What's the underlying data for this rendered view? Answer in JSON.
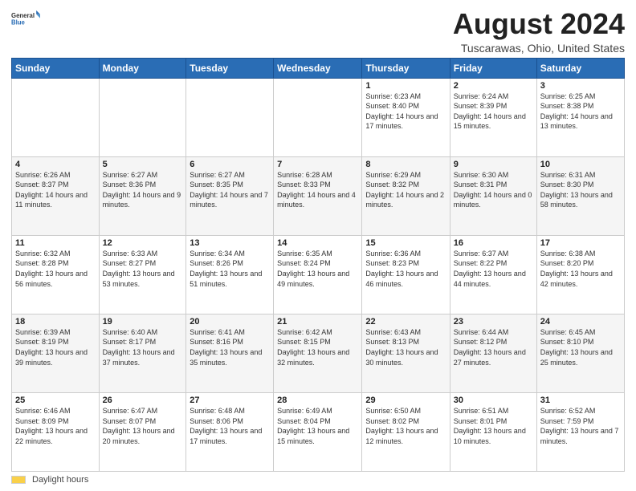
{
  "logo": {
    "general": "General",
    "blue": "Blue"
  },
  "title": "August 2024",
  "subtitle": "Tuscarawas, Ohio, United States",
  "legend": {
    "label": "Daylight hours"
  },
  "days_header": [
    "Sunday",
    "Monday",
    "Tuesday",
    "Wednesday",
    "Thursday",
    "Friday",
    "Saturday"
  ],
  "weeks": [
    [
      {
        "day": "",
        "info": ""
      },
      {
        "day": "",
        "info": ""
      },
      {
        "day": "",
        "info": ""
      },
      {
        "day": "",
        "info": ""
      },
      {
        "day": "1",
        "info": "Sunrise: 6:23 AM\nSunset: 8:40 PM\nDaylight: 14 hours and 17 minutes."
      },
      {
        "day": "2",
        "info": "Sunrise: 6:24 AM\nSunset: 8:39 PM\nDaylight: 14 hours and 15 minutes."
      },
      {
        "day": "3",
        "info": "Sunrise: 6:25 AM\nSunset: 8:38 PM\nDaylight: 14 hours and 13 minutes."
      }
    ],
    [
      {
        "day": "4",
        "info": "Sunrise: 6:26 AM\nSunset: 8:37 PM\nDaylight: 14 hours and 11 minutes."
      },
      {
        "day": "5",
        "info": "Sunrise: 6:27 AM\nSunset: 8:36 PM\nDaylight: 14 hours and 9 minutes."
      },
      {
        "day": "6",
        "info": "Sunrise: 6:27 AM\nSunset: 8:35 PM\nDaylight: 14 hours and 7 minutes."
      },
      {
        "day": "7",
        "info": "Sunrise: 6:28 AM\nSunset: 8:33 PM\nDaylight: 14 hours and 4 minutes."
      },
      {
        "day": "8",
        "info": "Sunrise: 6:29 AM\nSunset: 8:32 PM\nDaylight: 14 hours and 2 minutes."
      },
      {
        "day": "9",
        "info": "Sunrise: 6:30 AM\nSunset: 8:31 PM\nDaylight: 14 hours and 0 minutes."
      },
      {
        "day": "10",
        "info": "Sunrise: 6:31 AM\nSunset: 8:30 PM\nDaylight: 13 hours and 58 minutes."
      }
    ],
    [
      {
        "day": "11",
        "info": "Sunrise: 6:32 AM\nSunset: 8:28 PM\nDaylight: 13 hours and 56 minutes."
      },
      {
        "day": "12",
        "info": "Sunrise: 6:33 AM\nSunset: 8:27 PM\nDaylight: 13 hours and 53 minutes."
      },
      {
        "day": "13",
        "info": "Sunrise: 6:34 AM\nSunset: 8:26 PM\nDaylight: 13 hours and 51 minutes."
      },
      {
        "day": "14",
        "info": "Sunrise: 6:35 AM\nSunset: 8:24 PM\nDaylight: 13 hours and 49 minutes."
      },
      {
        "day": "15",
        "info": "Sunrise: 6:36 AM\nSunset: 8:23 PM\nDaylight: 13 hours and 46 minutes."
      },
      {
        "day": "16",
        "info": "Sunrise: 6:37 AM\nSunset: 8:22 PM\nDaylight: 13 hours and 44 minutes."
      },
      {
        "day": "17",
        "info": "Sunrise: 6:38 AM\nSunset: 8:20 PM\nDaylight: 13 hours and 42 minutes."
      }
    ],
    [
      {
        "day": "18",
        "info": "Sunrise: 6:39 AM\nSunset: 8:19 PM\nDaylight: 13 hours and 39 minutes."
      },
      {
        "day": "19",
        "info": "Sunrise: 6:40 AM\nSunset: 8:17 PM\nDaylight: 13 hours and 37 minutes."
      },
      {
        "day": "20",
        "info": "Sunrise: 6:41 AM\nSunset: 8:16 PM\nDaylight: 13 hours and 35 minutes."
      },
      {
        "day": "21",
        "info": "Sunrise: 6:42 AM\nSunset: 8:15 PM\nDaylight: 13 hours and 32 minutes."
      },
      {
        "day": "22",
        "info": "Sunrise: 6:43 AM\nSunset: 8:13 PM\nDaylight: 13 hours and 30 minutes."
      },
      {
        "day": "23",
        "info": "Sunrise: 6:44 AM\nSunset: 8:12 PM\nDaylight: 13 hours and 27 minutes."
      },
      {
        "day": "24",
        "info": "Sunrise: 6:45 AM\nSunset: 8:10 PM\nDaylight: 13 hours and 25 minutes."
      }
    ],
    [
      {
        "day": "25",
        "info": "Sunrise: 6:46 AM\nSunset: 8:09 PM\nDaylight: 13 hours and 22 minutes."
      },
      {
        "day": "26",
        "info": "Sunrise: 6:47 AM\nSunset: 8:07 PM\nDaylight: 13 hours and 20 minutes."
      },
      {
        "day": "27",
        "info": "Sunrise: 6:48 AM\nSunset: 8:06 PM\nDaylight: 13 hours and 17 minutes."
      },
      {
        "day": "28",
        "info": "Sunrise: 6:49 AM\nSunset: 8:04 PM\nDaylight: 13 hours and 15 minutes."
      },
      {
        "day": "29",
        "info": "Sunrise: 6:50 AM\nSunset: 8:02 PM\nDaylight: 13 hours and 12 minutes."
      },
      {
        "day": "30",
        "info": "Sunrise: 6:51 AM\nSunset: 8:01 PM\nDaylight: 13 hours and 10 minutes."
      },
      {
        "day": "31",
        "info": "Sunrise: 6:52 AM\nSunset: 7:59 PM\nDaylight: 13 hours and 7 minutes."
      }
    ]
  ]
}
